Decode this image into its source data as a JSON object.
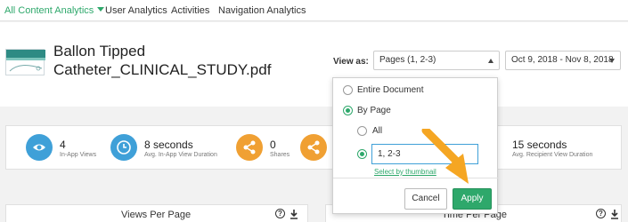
{
  "nav": {
    "tabs": [
      {
        "label": "All Content Analytics",
        "active": true
      },
      {
        "label": "User Analytics",
        "active": false
      },
      {
        "label": "Activities",
        "active": false
      },
      {
        "label": "Navigation Analytics",
        "active": false
      }
    ]
  },
  "document": {
    "title": "Ballon Tipped Catheter_CLINICAL_STUDY.pdf"
  },
  "view_as": {
    "label": "View as:",
    "value": "Pages (1, 2-3)"
  },
  "date_range": {
    "value": "Oct 9, 2018 - Nov 8, 2018"
  },
  "stats": [
    {
      "value": "4",
      "label": "In-App Views",
      "icon": "eye-icon",
      "color": "#3fa0d8"
    },
    {
      "value": "8 seconds",
      "label": "Avg. In-App View Duration",
      "icon": "clock-icon",
      "color": "#3fa0d8"
    },
    {
      "value": "0",
      "label": "Shares",
      "icon": "share-icon",
      "color": "#f0a033"
    },
    {
      "value": "",
      "label": "",
      "icon": "share-icon",
      "color": "#f0a033"
    },
    {
      "value": "15 seconds",
      "label": "Avg. Recipient View Duration",
      "icon": "",
      "color": ""
    }
  ],
  "panels": {
    "left_title": "Views Per Page",
    "right_title": "Time Per Page"
  },
  "popup": {
    "options": {
      "entire_document": "Entire Document",
      "by_page": "By Page",
      "all": "All"
    },
    "pages_value": "1, 2-3",
    "thumbnail_link": "Select by thumbnail",
    "cancel_label": "Cancel",
    "apply_label": "Apply"
  },
  "colors": {
    "accent": "#2ea86b",
    "blue": "#3fa0d8",
    "orange": "#f0a033",
    "arrow": "#f5a623"
  }
}
